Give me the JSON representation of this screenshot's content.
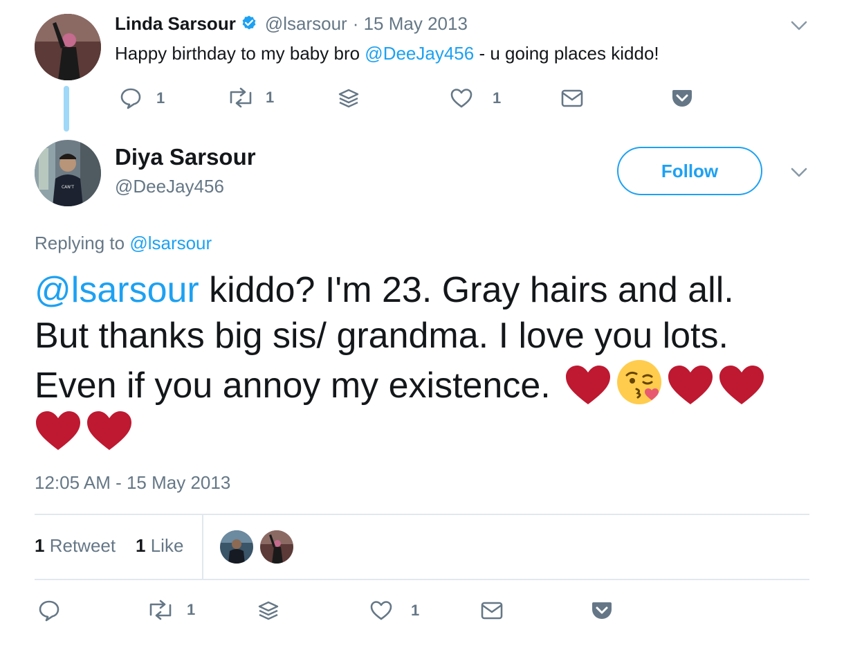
{
  "parent_tweet": {
    "author_name": "Linda Sarsour",
    "verified_icon": "verified-badge-icon",
    "handle": "@lsarsour",
    "date": "· 15 May 2013",
    "text_before": "Happy birthday to my baby bro ",
    "mention": "@DeeJay456",
    "text_after": " - u going places kiddo!",
    "actions": {
      "reply_count": "1",
      "retweet_count": "1",
      "like_count": "1"
    }
  },
  "main_tweet": {
    "author_name": "Diya Sarsour",
    "handle": "@DeeJay456",
    "follow_label": "Follow",
    "replying_prefix": "Replying to ",
    "replying_handle": "@lsarsour",
    "mention": "@lsarsour",
    "text_line1_rest": " kiddo? I'm 23. Gray hairs and all.",
    "text_line2": "But thanks big sis/ grandma. I love you lots.",
    "text_line3": "Even if you annoy my existence. ",
    "timestamp": "12:05 AM - 15 May 2013",
    "stats": {
      "retweets_count": "1",
      "retweets_label": "Retweet",
      "likes_count": "1",
      "likes_label": "Like"
    },
    "actions": {
      "retweet_count": "1",
      "like_count": "1"
    }
  },
  "colors": {
    "accent": "#1da1f2",
    "follow_border": "#1da1f2",
    "text_secondary": "#657786",
    "heart_red": "#be1931",
    "thread_line": "#9fd8f8"
  },
  "icons": [
    "reply-icon",
    "retweet-icon",
    "stack-icon",
    "like-icon",
    "direct-message-icon",
    "pocket-icon",
    "chevron-down-icon"
  ]
}
